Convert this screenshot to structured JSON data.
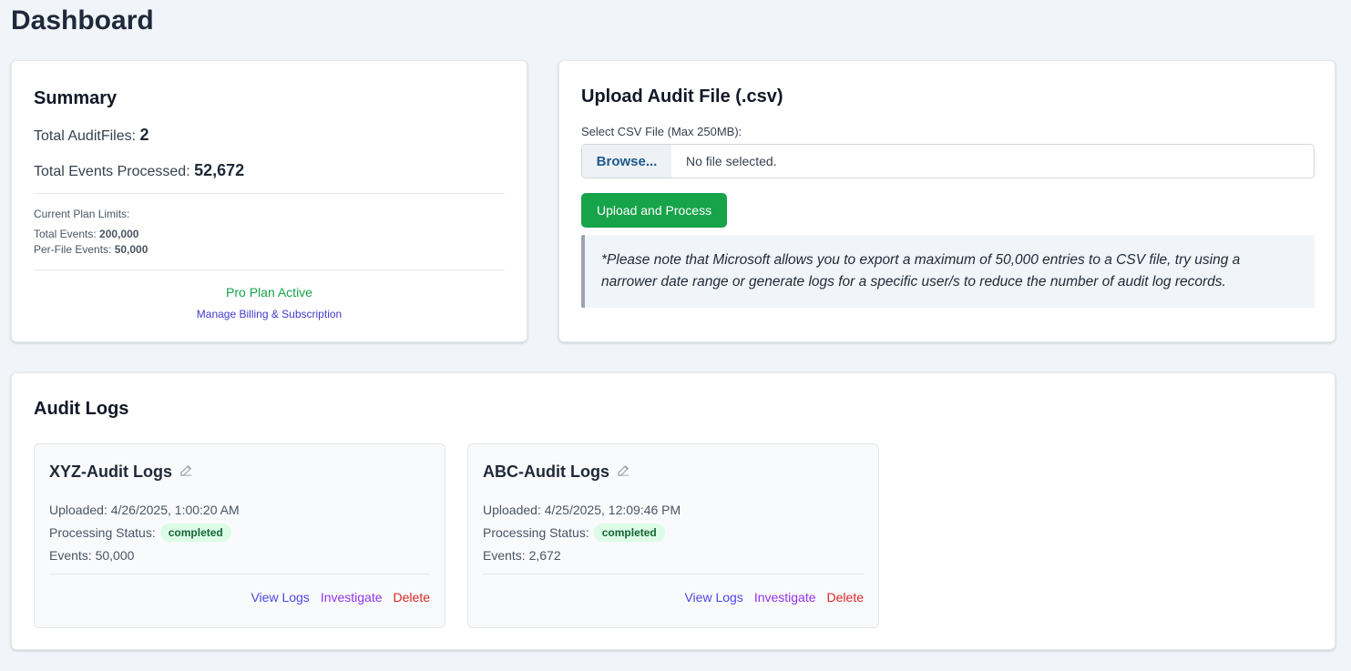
{
  "page": {
    "title": "Dashboard"
  },
  "summary": {
    "title": "Summary",
    "total_files_label": "Total AuditFiles: ",
    "total_files_value": "2",
    "total_events_label": "Total Events Processed: ",
    "total_events_value": "52,672",
    "limits_heading": "Current Plan Limits:",
    "limit_total_label": "Total Events: ",
    "limit_total_value": "200,000",
    "limit_perfile_label": "Per-File Events: ",
    "limit_perfile_value": "50,000",
    "plan_status": "Pro Plan Active",
    "billing_link": "Manage Billing & Subscription"
  },
  "upload": {
    "title": "Upload Audit File (.csv)",
    "file_label": "Select CSV File (Max 250MB):",
    "browse_label": "Browse...",
    "no_file_text": "No file selected.",
    "upload_button": "Upload and Process",
    "note": "*Please note that Microsoft allows you to export a maximum of 50,000 entries to a CSV file, try using a narrower date range or generate logs for a specific user/s to reduce the number of audit log records."
  },
  "audit_logs": {
    "title": "Audit Logs",
    "uploaded_label": "Uploaded: ",
    "status_label": "Processing Status:",
    "events_label": "Events: ",
    "actions": {
      "view": "View Logs",
      "investigate": "Investigate",
      "delete": "Delete"
    },
    "items": [
      {
        "name": "XYZ-Audit Logs",
        "uploaded": "4/26/2025, 1:00:20 AM",
        "status": "completed",
        "events": "50,000"
      },
      {
        "name": "ABC-Audit Logs",
        "uploaded": "4/25/2025, 12:09:46 PM",
        "status": "completed",
        "events": "2,672"
      }
    ]
  },
  "colors": {
    "accent_green": "#16a34a",
    "link_indigo": "#4f46e5",
    "link_purple": "#9333ea",
    "danger_red": "#dc2626"
  },
  "icons": {
    "edit": "pencil-edit-icon"
  }
}
